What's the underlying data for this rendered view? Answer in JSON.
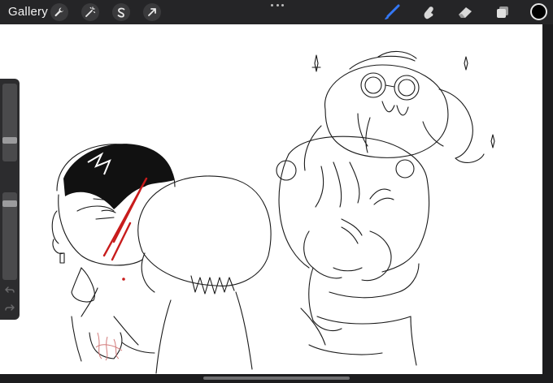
{
  "toolbar": {
    "gallery_label": "Gallery",
    "left_tools": [
      {
        "name": "actions",
        "icon": "wrench-icon"
      },
      {
        "name": "adjustments",
        "icon": "magic-wand-icon"
      },
      {
        "name": "selection",
        "icon": "selection-s-icon"
      },
      {
        "name": "transform",
        "icon": "arrow-cursor-icon"
      }
    ],
    "more_icon": "more-dots-icon",
    "right_tools": [
      {
        "name": "brush",
        "icon": "brush-icon",
        "active": true
      },
      {
        "name": "smudge",
        "icon": "smudge-finger-icon",
        "active": false
      },
      {
        "name": "eraser",
        "icon": "eraser-icon",
        "active": false
      },
      {
        "name": "layers",
        "icon": "layers-icon",
        "active": false
      }
    ],
    "current_color": "#000000",
    "accent_color": "#3478f6"
  },
  "sidebar": {
    "brush_size": 0.25,
    "opacity": 0.9
  }
}
